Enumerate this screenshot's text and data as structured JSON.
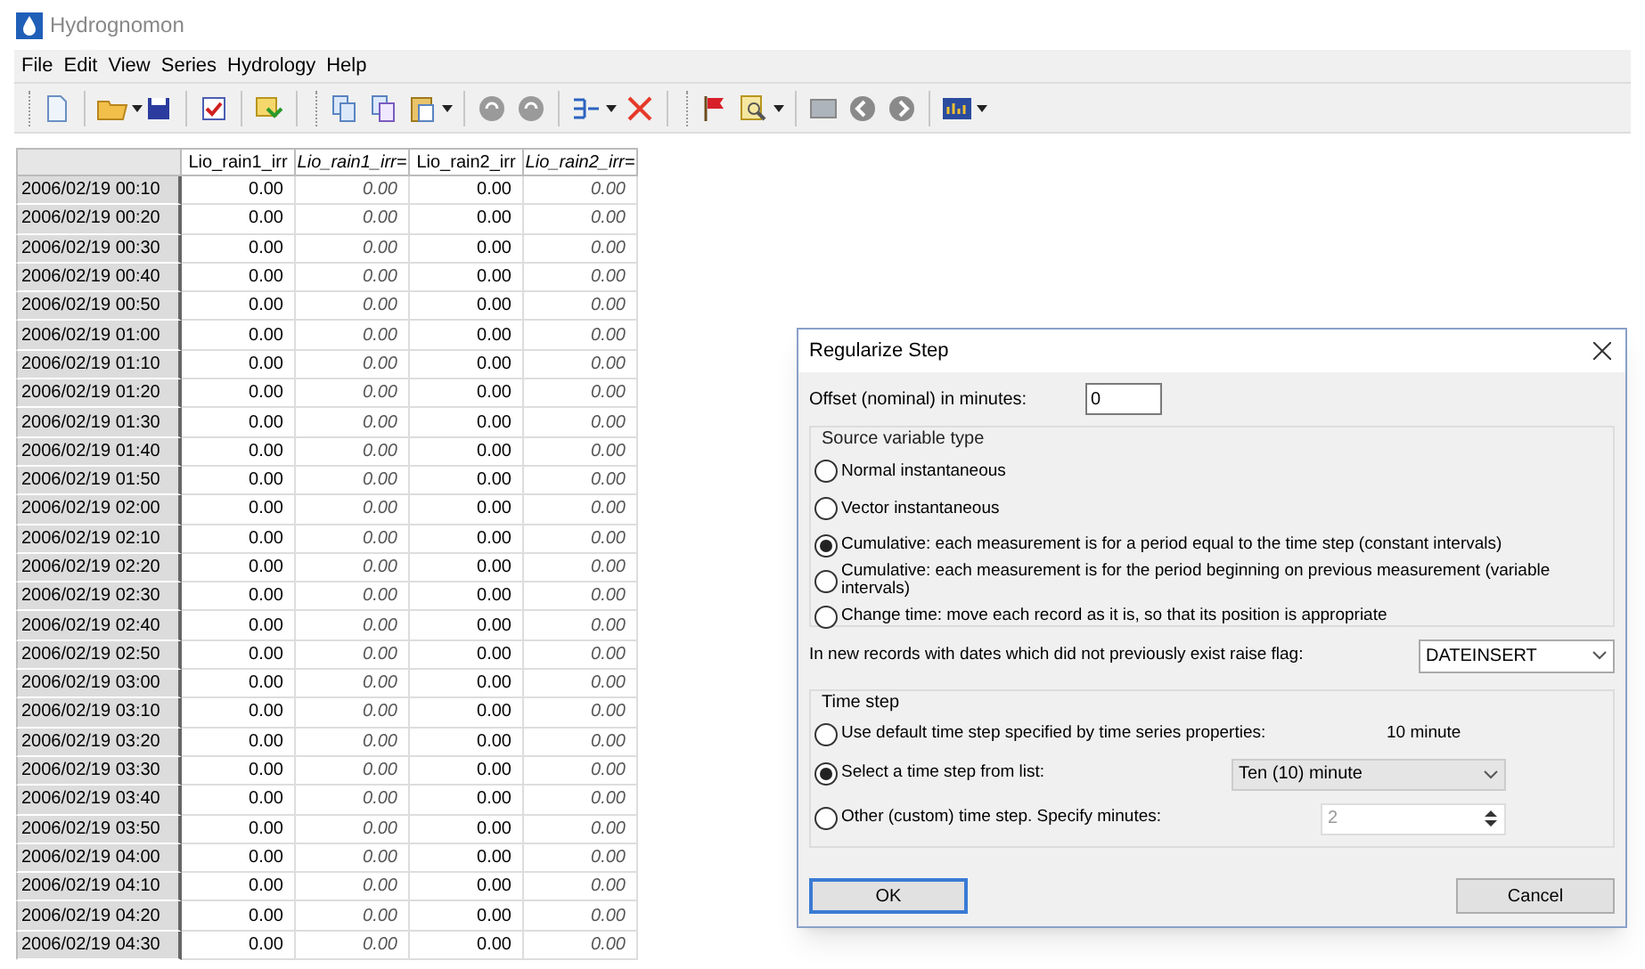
{
  "window": {
    "title": "Hydrognomon"
  },
  "menu": [
    "File",
    "Edit",
    "View",
    "Series",
    "Hydrology",
    "Help"
  ],
  "table": {
    "columns": [
      {
        "label": "Lio_rain1_irr",
        "italic": false
      },
      {
        "label": "Lio_rain1_irr=",
        "italic": true
      },
      {
        "label": "Lio_rain2_irr",
        "italic": false
      },
      {
        "label": "Lio_rain2_irr=",
        "italic": true
      }
    ],
    "rows": [
      {
        "date": "2006/02/19 00:10",
        "values": [
          "0.00",
          "0.00",
          "0.00",
          "0.00"
        ]
      },
      {
        "date": "2006/02/19 00:20",
        "values": [
          "0.00",
          "0.00",
          "0.00",
          "0.00"
        ]
      },
      {
        "date": "2006/02/19 00:30",
        "values": [
          "0.00",
          "0.00",
          "0.00",
          "0.00"
        ]
      },
      {
        "date": "2006/02/19 00:40",
        "values": [
          "0.00",
          "0.00",
          "0.00",
          "0.00"
        ]
      },
      {
        "date": "2006/02/19 00:50",
        "values": [
          "0.00",
          "0.00",
          "0.00",
          "0.00"
        ]
      },
      {
        "date": "2006/02/19 01:00",
        "values": [
          "0.00",
          "0.00",
          "0.00",
          "0.00"
        ]
      },
      {
        "date": "2006/02/19 01:10",
        "values": [
          "0.00",
          "0.00",
          "0.00",
          "0.00"
        ]
      },
      {
        "date": "2006/02/19 01:20",
        "values": [
          "0.00",
          "0.00",
          "0.00",
          "0.00"
        ]
      },
      {
        "date": "2006/02/19 01:30",
        "values": [
          "0.00",
          "0.00",
          "0.00",
          "0.00"
        ]
      },
      {
        "date": "2006/02/19 01:40",
        "values": [
          "0.00",
          "0.00",
          "0.00",
          "0.00"
        ]
      },
      {
        "date": "2006/02/19 01:50",
        "values": [
          "0.00",
          "0.00",
          "0.00",
          "0.00"
        ]
      },
      {
        "date": "2006/02/19 02:00",
        "values": [
          "0.00",
          "0.00",
          "0.00",
          "0.00"
        ]
      },
      {
        "date": "2006/02/19 02:10",
        "values": [
          "0.00",
          "0.00",
          "0.00",
          "0.00"
        ]
      },
      {
        "date": "2006/02/19 02:20",
        "values": [
          "0.00",
          "0.00",
          "0.00",
          "0.00"
        ]
      },
      {
        "date": "2006/02/19 02:30",
        "values": [
          "0.00",
          "0.00",
          "0.00",
          "0.00"
        ]
      },
      {
        "date": "2006/02/19 02:40",
        "values": [
          "0.00",
          "0.00",
          "0.00",
          "0.00"
        ]
      },
      {
        "date": "2006/02/19 02:50",
        "values": [
          "0.00",
          "0.00",
          "0.00",
          "0.00"
        ]
      },
      {
        "date": "2006/02/19 03:00",
        "values": [
          "0.00",
          "0.00",
          "0.00",
          "0.00"
        ]
      },
      {
        "date": "2006/02/19 03:10",
        "values": [
          "0.00",
          "0.00",
          "0.00",
          "0.00"
        ]
      },
      {
        "date": "2006/02/19 03:20",
        "values": [
          "0.00",
          "0.00",
          "0.00",
          "0.00"
        ]
      },
      {
        "date": "2006/02/19 03:30",
        "values": [
          "0.00",
          "0.00",
          "0.00",
          "0.00"
        ]
      },
      {
        "date": "2006/02/19 03:40",
        "values": [
          "0.00",
          "0.00",
          "0.00",
          "0.00"
        ]
      },
      {
        "date": "2006/02/19 03:50",
        "values": [
          "0.00",
          "0.00",
          "0.00",
          "0.00"
        ]
      },
      {
        "date": "2006/02/19 04:00",
        "values": [
          "0.00",
          "0.00",
          "0.00",
          "0.00"
        ]
      },
      {
        "date": "2006/02/19 04:10",
        "values": [
          "0.00",
          "0.00",
          "0.00",
          "0.00"
        ]
      },
      {
        "date": "2006/02/19 04:20",
        "values": [
          "0.00",
          "0.00",
          "0.00",
          "0.00"
        ]
      },
      {
        "date": "2006/02/19 04:30",
        "values": [
          "0.00",
          "0.00",
          "0.00",
          "0.00"
        ]
      }
    ]
  },
  "dialog": {
    "title": "Regularize Step",
    "offset_label": "Offset (nominal) in minutes:",
    "offset_value": "0",
    "source_group": {
      "title": "Source variable type",
      "options": [
        {
          "label": "Normal instantaneous",
          "selected": false
        },
        {
          "label": "Vector instantaneous",
          "selected": false
        },
        {
          "label": "Cumulative: each measurement is for a period equal to the time step (constant intervals)",
          "selected": true
        },
        {
          "label": "Cumulative: each measurement is for the period beginning on previous measurement (variable intervals)",
          "selected": false
        },
        {
          "label": "Change time: move each record as it is, so that its position is appropriate",
          "selected": false
        }
      ]
    },
    "flag_label": "In new records with dates which did not previously exist raise flag:",
    "flag_value": "DATEINSERT",
    "time_step_group": {
      "title": "Time step",
      "options": [
        {
          "kind": "text",
          "label": "Use default time step specified by time series properties:",
          "value": "10 minute",
          "selected": false
        },
        {
          "kind": "select",
          "label": "Select a time step from list:",
          "value": "Ten (10) minute",
          "selected": true
        },
        {
          "kind": "spin",
          "label": "Other (custom) time step. Specify minutes:",
          "value": "2",
          "selected": false
        }
      ]
    },
    "buttons": [
      {
        "label": "OK",
        "default": true
      },
      {
        "label": "Cancel",
        "default": false
      }
    ]
  }
}
